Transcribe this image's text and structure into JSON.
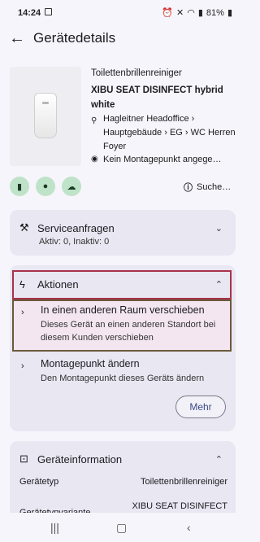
{
  "status": {
    "time": "14:24",
    "battery": "81%"
  },
  "appbar": {
    "title": "Gerätedetails"
  },
  "product": {
    "name": "Toilettenbrillenreiniger",
    "model": "XIBU SEAT DISINFECT hybrid white",
    "location": "Hagleitner Headoffice › Hauptgebäude › EG › WC Herren Foyer",
    "mount": "Kein Montagepunkt angege…"
  },
  "icons": {
    "c1": "battery-icon",
    "c2": "drop-icon",
    "c3": "cloud-icon"
  },
  "search_label": "Suche…",
  "service": {
    "title": "Serviceanfragen",
    "summary": "Aktiv: 0, Inaktiv: 0"
  },
  "actions": {
    "title": "Aktionen",
    "items": [
      {
        "title": "In einen anderen Raum verschieben",
        "desc": "Dieses Gerät an einen anderen Standort bei diesem Kunden verschieben"
      },
      {
        "title": "Montagepunkt ändern",
        "desc": "Den Montagepunkt dieses Geräts ändern"
      }
    ],
    "more": "Mehr"
  },
  "info": {
    "title": "Geräteinformation",
    "rows": [
      {
        "k": "Gerätetyp",
        "v": "Toilettenbrillenreiniger"
      },
      {
        "k": "Gerätetypvariante",
        "v": "XIBU SEAT DISINFECT"
      }
    ]
  },
  "colors": {
    "accent": "#3c4a86",
    "chip": "#bfe3c8",
    "card": "#e8e7f2"
  }
}
